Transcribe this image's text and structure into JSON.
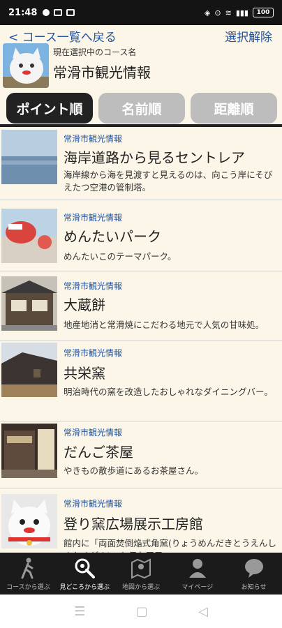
{
  "status": {
    "time": "21:48",
    "battery": "100"
  },
  "topbar": {
    "back": "< コース一覧へ戻る",
    "clear": "選択解除"
  },
  "course": {
    "caption": "現在選択中のコース名",
    "name": "常滑市観光情報"
  },
  "tabs": [
    "ポイント順",
    "名前順",
    "距離順"
  ],
  "items": [
    {
      "tag": "常滑市観光情報",
      "title": "海岸道路から見るセントレア",
      "desc": "海岸線から海を見渡すと見えるのは、向こう岸にそびえたつ空港の管制塔。"
    },
    {
      "tag": "常滑市観光情報",
      "title": "めんたいパーク",
      "desc": "めんたいこのテーマパーク。"
    },
    {
      "tag": "常滑市観光情報",
      "title": "大蔵餅",
      "desc": "地産地消と常滑焼にこだわる地元で人気の甘味処。"
    },
    {
      "tag": "常滑市観光情報",
      "title": "共栄窯",
      "desc": "明治時代の窯を改造したおしゃれなダイニングバー。"
    },
    {
      "tag": "常滑市観光情報",
      "title": "だんご茶屋",
      "desc": "やきもの散歩道にあるお茶屋さん。"
    },
    {
      "tag": "常滑市観光情報",
      "title": "登り窯広場展示工房館",
      "desc": "館内に「両面焚倒焔式角窯(りょうめんだきとうえんしきかくがま)」を保存展示。"
    }
  ],
  "nav": [
    "コースから選ぶ",
    "見どころから選ぶ",
    "地図から選ぶ",
    "マイページ",
    "お知らせ"
  ],
  "sysnav": {
    "menu": "☰",
    "home": "▢",
    "back": "◁"
  }
}
